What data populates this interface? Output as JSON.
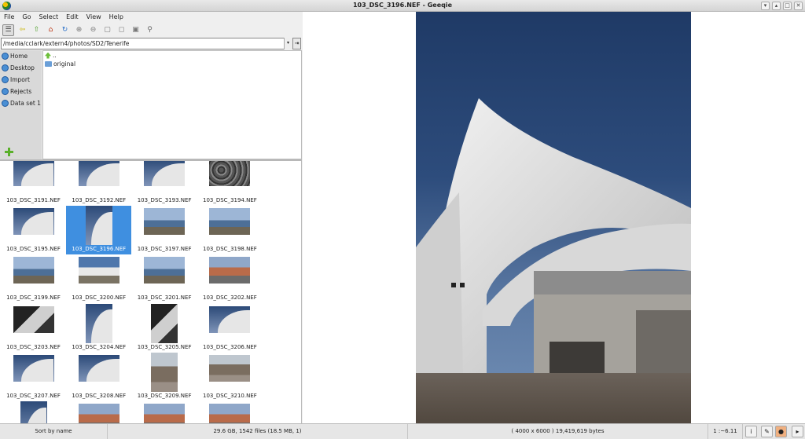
{
  "window": {
    "title": "103_DSC_3196.NEF - Geeqie"
  },
  "menu": [
    "File",
    "Go",
    "Select",
    "Edit",
    "View",
    "Help"
  ],
  "path": {
    "value": "/media/cclark/extern4/photos/SD2/Tenerife"
  },
  "bookmarks": [
    "Home",
    "Desktop",
    "Import",
    "Rejects",
    "Data set 1"
  ],
  "dirs": [
    "..",
    "original"
  ],
  "thumbnails": [
    {
      "name": "103_DSC_3191.NEF",
      "style": "t-sky",
      "shape": "land"
    },
    {
      "name": "103_DSC_3192.NEF",
      "style": "t-sky",
      "shape": "land"
    },
    {
      "name": "103_DSC_3193.NEF",
      "style": "t-sky",
      "shape": "land"
    },
    {
      "name": "103_DSC_3194.NEF",
      "style": "t-rocks",
      "shape": "land"
    },
    {
      "name": "103_DSC_3195.NEF",
      "style": "t-sky",
      "shape": "land"
    },
    {
      "name": "103_DSC_3196.NEF",
      "style": "t-sky",
      "shape": "port",
      "selected": true
    },
    {
      "name": "103_DSC_3197.NEF",
      "style": "t-sea",
      "shape": "land"
    },
    {
      "name": "103_DSC_3198.NEF",
      "style": "t-sea",
      "shape": "land"
    },
    {
      "name": "103_DSC_3199.NEF",
      "style": "t-sea",
      "shape": "land"
    },
    {
      "name": "103_DSC_3200.NEF",
      "style": "t-opera",
      "shape": "land"
    },
    {
      "name": "103_DSC_3201.NEF",
      "style": "t-sea",
      "shape": "land"
    },
    {
      "name": "103_DSC_3202.NEF",
      "style": "t-city",
      "shape": "land"
    },
    {
      "name": "103_DSC_3203.NEF",
      "style": "t-dark",
      "shape": "land"
    },
    {
      "name": "103_DSC_3204.NEF",
      "style": "t-sky",
      "shape": "port"
    },
    {
      "name": "103_DSC_3205.NEF",
      "style": "t-dark",
      "shape": "port"
    },
    {
      "name": "103_DSC_3206.NEF",
      "style": "t-sky",
      "shape": "land"
    },
    {
      "name": "103_DSC_3207.NEF",
      "style": "t-sky",
      "shape": "land"
    },
    {
      "name": "103_DSC_3208.NEF",
      "style": "t-sky",
      "shape": "land"
    },
    {
      "name": "103_DSC_3209.NEF",
      "style": "t-street",
      "shape": "port"
    },
    {
      "name": "103_DSC_3210.NEF",
      "style": "t-street",
      "shape": "land"
    },
    {
      "name": "",
      "style": "t-sky",
      "shape": "port"
    },
    {
      "name": "",
      "style": "t-city",
      "shape": "land"
    },
    {
      "name": "",
      "style": "t-city",
      "shape": "land"
    },
    {
      "name": "",
      "style": "t-city",
      "shape": "land"
    }
  ],
  "status": {
    "sort": "Sort by name",
    "files": "29.6 GB, 1542 files (18.5 MB, 1)",
    "image_info": "( 4000 x 6000 ) 19,419,619 bytes",
    "zoom": "1 :~6.11"
  }
}
